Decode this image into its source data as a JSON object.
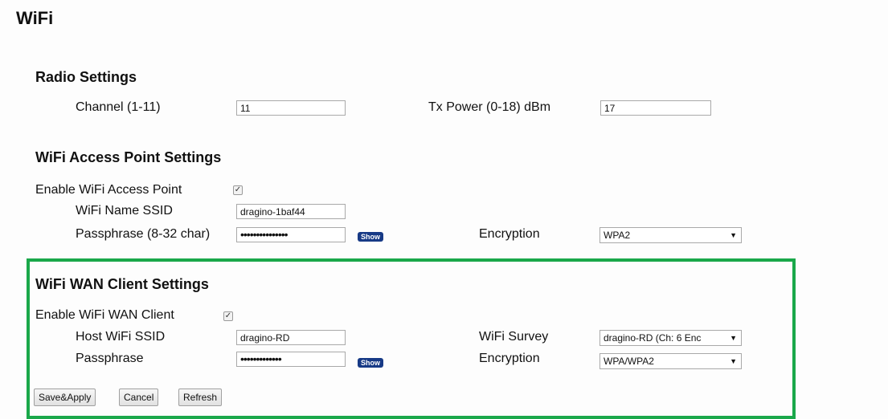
{
  "page_title": "WiFi",
  "radio": {
    "heading": "Radio Settings",
    "channel_label": "Channel (1-11)",
    "channel_value": "11",
    "txpower_label": "Tx Power (0-18) dBm",
    "txpower_value": "17"
  },
  "ap": {
    "heading": "WiFi Access Point Settings",
    "enable_label": "Enable WiFi Access Point",
    "enabled": true,
    "ssid_label": "WiFi Name SSID",
    "ssid_value": "dragino-1baf44",
    "pass_label": "Passphrase (8-32 char)",
    "pass_value": "•••••••••••••••",
    "show_label": "Show",
    "enc_label": "Encryption",
    "enc_value": "WPA2"
  },
  "wan": {
    "heading": "WiFi WAN Client Settings",
    "enable_label": "Enable WiFi WAN Client",
    "enabled": true,
    "ssid_label": "Host WiFi SSID",
    "ssid_value": "dragino-RD",
    "survey_label": "WiFi Survey",
    "survey_value": "dragino-RD (Ch: 6 Enc",
    "pass_label": "Passphrase",
    "pass_value": "•••••••••••••",
    "show_label": "Show",
    "enc_label": "Encryption",
    "enc_value": "WPA/WPA2"
  },
  "buttons": {
    "save": "Save&Apply",
    "cancel": "Cancel",
    "refresh": "Refresh"
  },
  "colors": {
    "highlight_border": "#1aa84a",
    "show_button": "#173a86"
  },
  "icons": {
    "checkbox_checked": "check-mark",
    "dropdown": "triangle-down"
  }
}
